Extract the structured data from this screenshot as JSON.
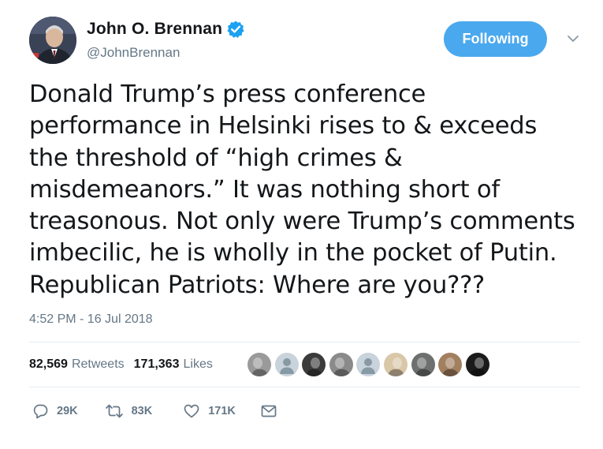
{
  "author": {
    "name": "John O. Brennan",
    "handle": "@JohnBrennan",
    "verified": true
  },
  "follow_button": {
    "label": "Following",
    "color": "#4aa8ee"
  },
  "tweet": {
    "text": "Donald Trump’s press conference\nperformance in Helsinki rises to & exceeds\nthe threshold of “high crimes &\nmisdemeanors.” It was nothing short of\ntreasonous. Not only were Trump’s comments\nimbecilic, he is wholly in the pocket of Putin.\nRepublican Patriots: Where are you???",
    "timestamp": "4:52 PM - 16 Jul 2018"
  },
  "stats": {
    "retweets_count": "82,569",
    "retweets_label": "Retweets",
    "likes_count": "171,363",
    "likes_label": "Likes"
  },
  "liker_avatars": [
    {
      "icon": "liker-avatar-icon",
      "color": "#9a9a9a",
      "kind": "photo"
    },
    {
      "icon": "default-profile-icon",
      "color": "#c9d3db",
      "kind": "default"
    },
    {
      "icon": "liker-avatar-icon",
      "color": "#3b3b3b",
      "kind": "photo"
    },
    {
      "icon": "liker-avatar-icon",
      "color": "#8a8a8a",
      "kind": "photo"
    },
    {
      "icon": "default-profile-icon",
      "color": "#c9d3db",
      "kind": "default"
    },
    {
      "icon": "liker-avatar-icon",
      "color": "#d9c7a8",
      "kind": "photo"
    },
    {
      "icon": "liker-avatar-icon",
      "color": "#6e7070",
      "kind": "photo"
    },
    {
      "icon": "liker-avatar-icon",
      "color": "#a17f5f",
      "kind": "photo"
    },
    {
      "icon": "liker-avatar-icon",
      "color": "#1b1b1b",
      "kind": "photo"
    }
  ],
  "actions": {
    "reply_count": "29K",
    "retweet_count": "83K",
    "like_count": "171K"
  },
  "colors": {
    "text": "#14171a",
    "secondary": "#657786",
    "divider": "#e6ecf0",
    "verified_badge": "#1da1f2"
  }
}
